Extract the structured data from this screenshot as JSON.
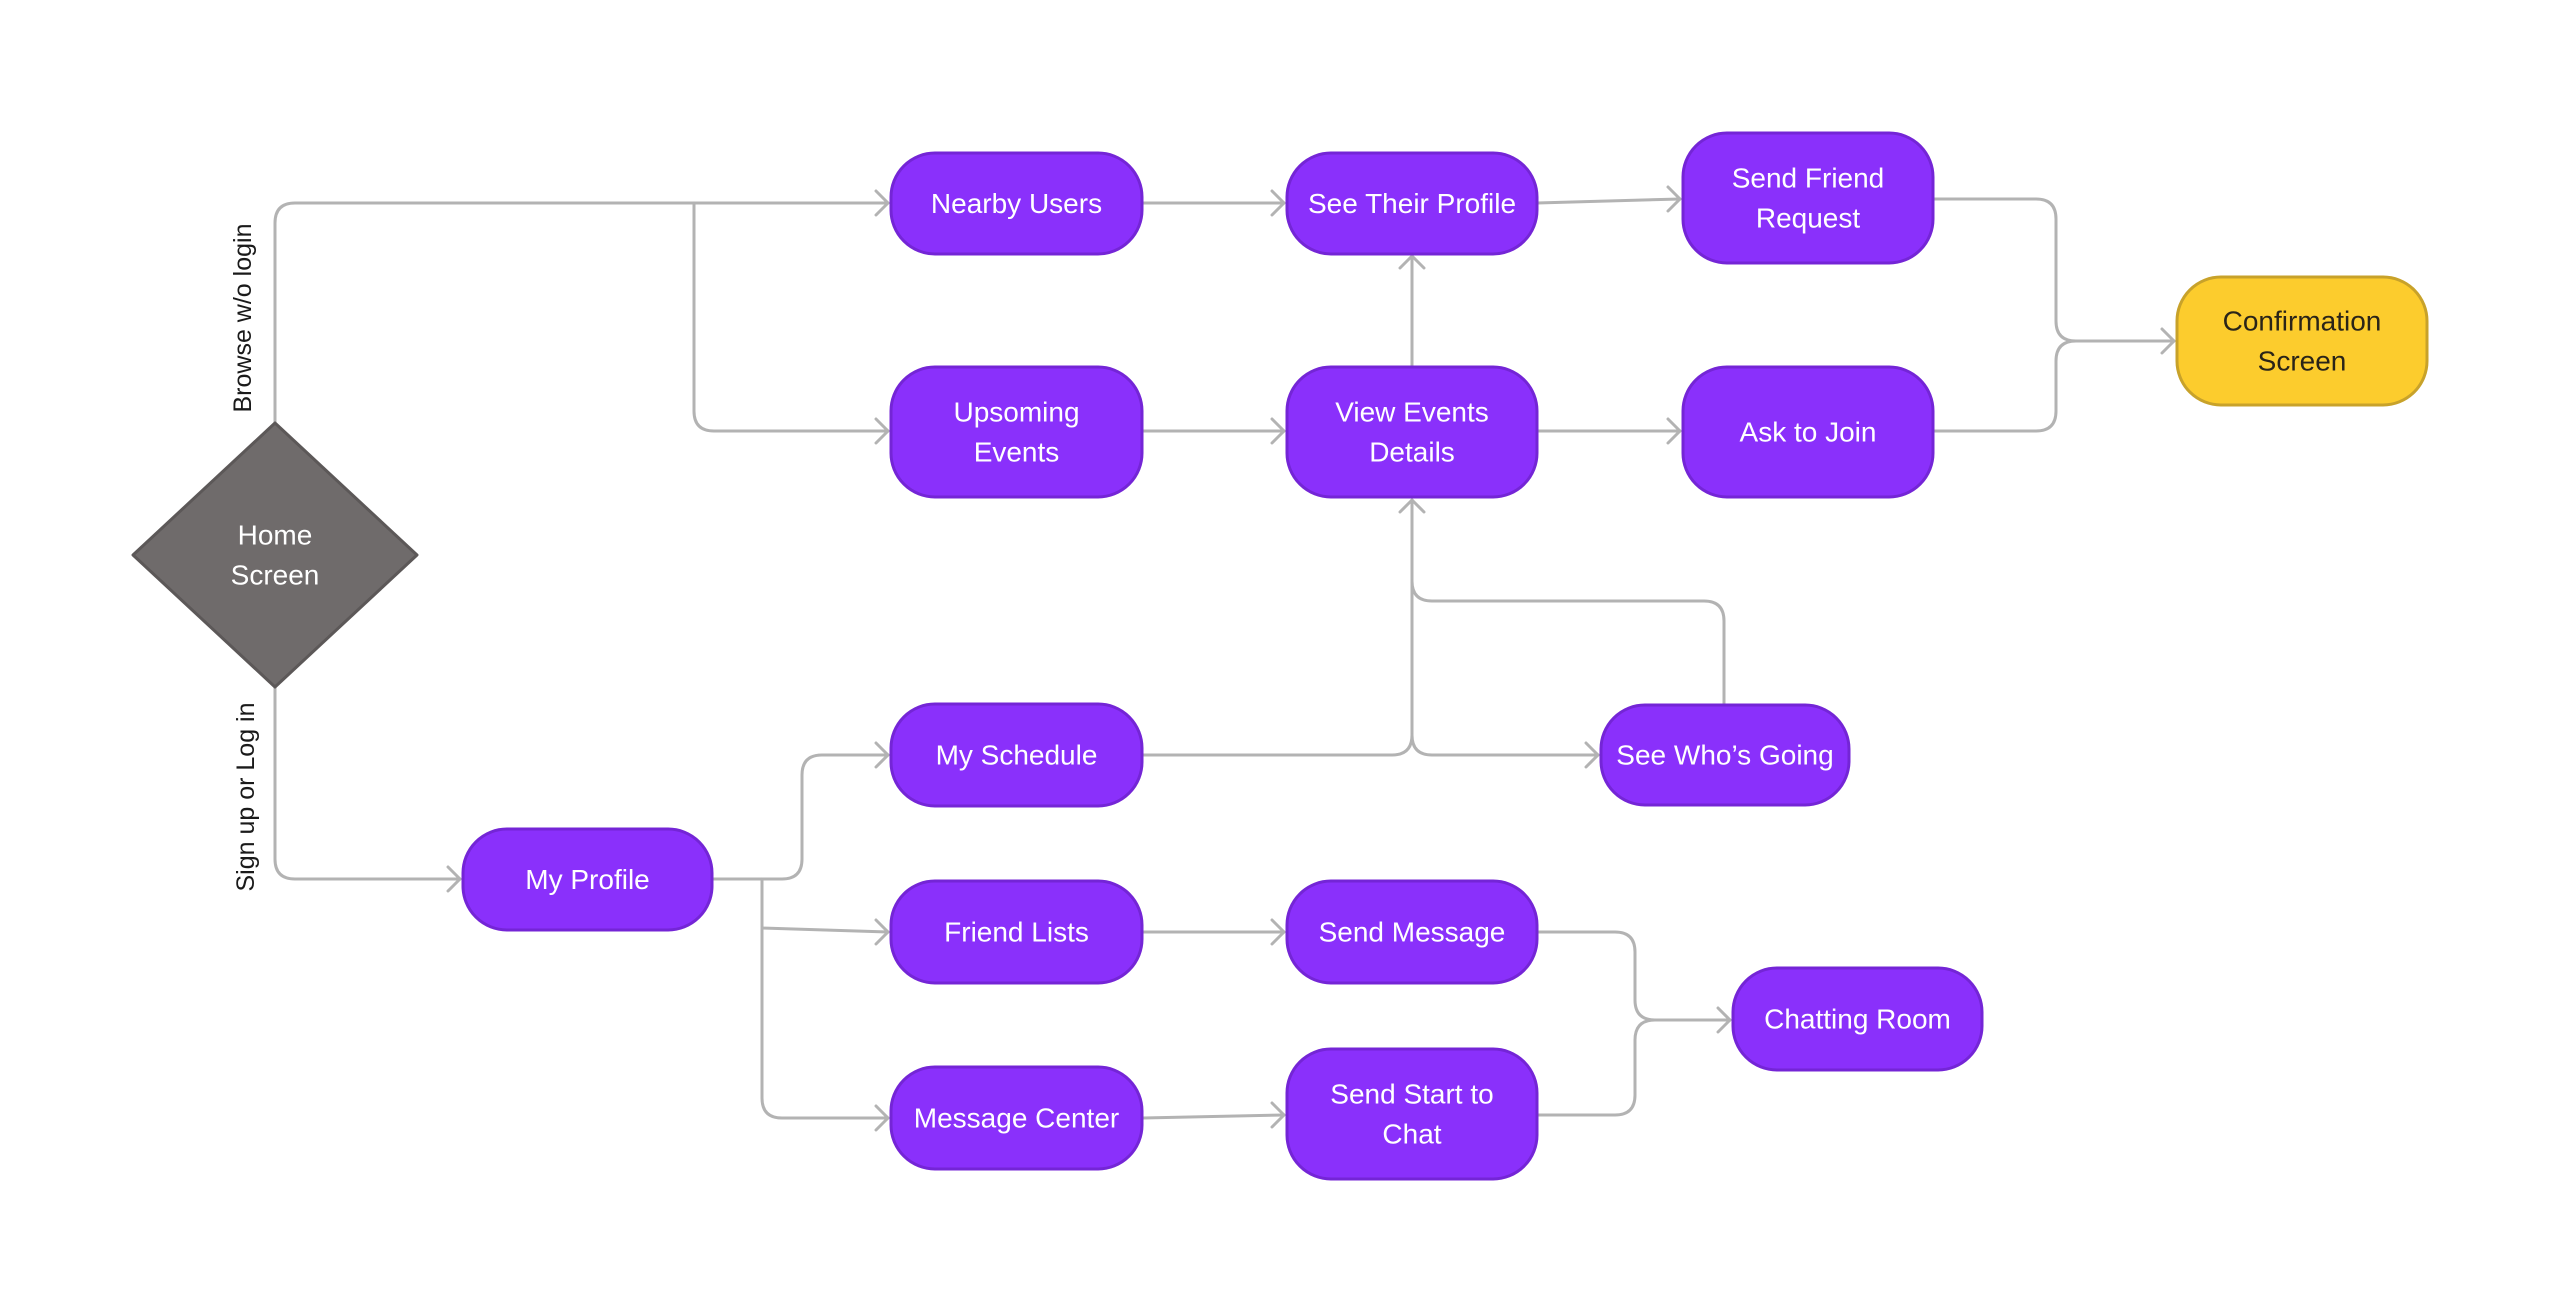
{
  "diagram": {
    "title": "",
    "colors": {
      "process_fill": "#8a30fb",
      "process_border": "#7425d6",
      "start_fill": "#6f6b6b",
      "start_border": "#5c5858",
      "end_fill": "#fccc2d",
      "end_border": "#c8a22a",
      "edge": "#b3b3b3"
    },
    "nodes": [
      {
        "id": "home",
        "type": "decision",
        "lines": [
          "Home",
          "Screen"
        ]
      },
      {
        "id": "nearby_users",
        "type": "process",
        "lines": [
          "Nearby Users"
        ]
      },
      {
        "id": "see_their_profile",
        "type": "process",
        "lines": [
          "See Their Profile"
        ]
      },
      {
        "id": "send_friend_request",
        "type": "process",
        "lines": [
          "Send Friend",
          "Request"
        ]
      },
      {
        "id": "upcoming_events",
        "type": "process",
        "lines": [
          "Upsoming",
          "Events"
        ]
      },
      {
        "id": "view_events_details",
        "type": "process",
        "lines": [
          "View Events",
          "Details"
        ]
      },
      {
        "id": "ask_to_join",
        "type": "process",
        "lines": [
          "Ask to Join"
        ]
      },
      {
        "id": "confirmation_screen",
        "type": "terminal",
        "lines": [
          "Confirmation",
          "Screen"
        ]
      },
      {
        "id": "my_profile",
        "type": "process",
        "lines": [
          "My Profile"
        ]
      },
      {
        "id": "my_schedule",
        "type": "process",
        "lines": [
          "My Schedule"
        ]
      },
      {
        "id": "see_whos_going",
        "type": "process",
        "lines": [
          "See Who’s Going"
        ]
      },
      {
        "id": "friend_lists",
        "type": "process",
        "lines": [
          "Friend Lists"
        ]
      },
      {
        "id": "send_message",
        "type": "process",
        "lines": [
          "Send Message"
        ]
      },
      {
        "id": "message_center",
        "type": "process",
        "lines": [
          "Message Center"
        ]
      },
      {
        "id": "send_start_to_chat",
        "type": "process",
        "lines": [
          "Send Start to",
          "Chat"
        ]
      },
      {
        "id": "chatting_room",
        "type": "process",
        "lines": [
          "Chatting Room"
        ]
      }
    ],
    "edges": [
      {
        "from": "home",
        "to": "nearby_users",
        "label": "Browse w/o login"
      },
      {
        "from": "home",
        "to": "upcoming_events",
        "label": ""
      },
      {
        "from": "nearby_users",
        "to": "see_their_profile",
        "label": ""
      },
      {
        "from": "see_their_profile",
        "to": "send_friend_request",
        "label": ""
      },
      {
        "from": "upcoming_events",
        "to": "view_events_details",
        "label": ""
      },
      {
        "from": "view_events_details",
        "to": "see_their_profile",
        "label": ""
      },
      {
        "from": "view_events_details",
        "to": "ask_to_join",
        "label": ""
      },
      {
        "from": "send_friend_request",
        "to": "confirmation_screen",
        "label": ""
      },
      {
        "from": "ask_to_join",
        "to": "confirmation_screen",
        "label": ""
      },
      {
        "from": "home",
        "to": "my_profile",
        "label": "Sign up or Log in"
      },
      {
        "from": "my_profile",
        "to": "my_schedule",
        "label": ""
      },
      {
        "from": "my_profile",
        "to": "friend_lists",
        "label": ""
      },
      {
        "from": "my_profile",
        "to": "message_center",
        "label": ""
      },
      {
        "from": "my_schedule",
        "to": "view_events_details",
        "label": ""
      },
      {
        "from": "my_schedule",
        "to": "see_whos_going",
        "label": ""
      },
      {
        "from": "see_whos_going",
        "to": "view_events_details",
        "label": ""
      },
      {
        "from": "friend_lists",
        "to": "send_message",
        "label": ""
      },
      {
        "from": "message_center",
        "to": "send_start_to_chat",
        "label": ""
      },
      {
        "from": "send_message",
        "to": "chatting_room",
        "label": ""
      },
      {
        "from": "send_start_to_chat",
        "to": "chatting_room",
        "label": ""
      }
    ]
  }
}
